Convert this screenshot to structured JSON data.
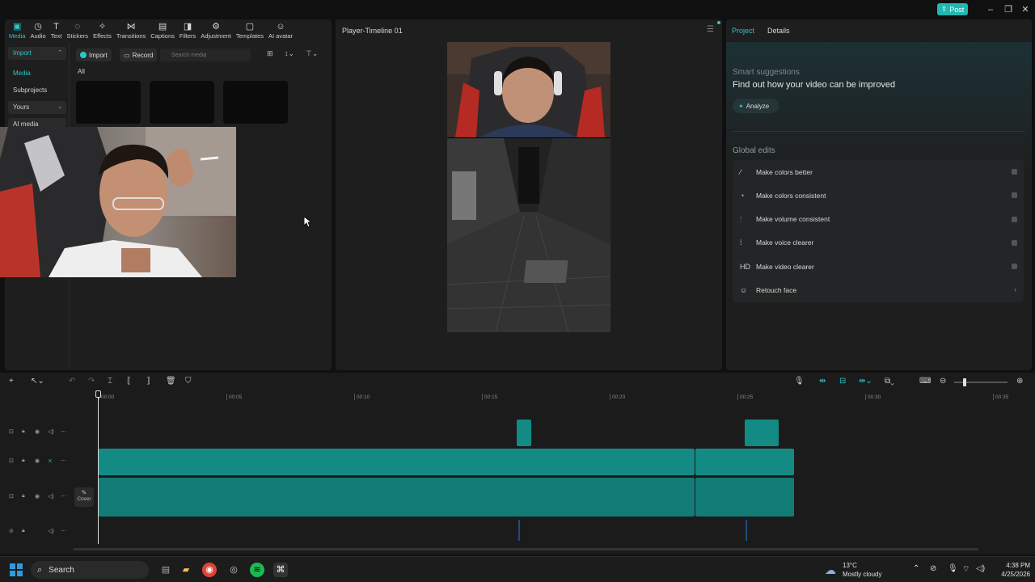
{
  "topbar": {
    "post_label": "Post"
  },
  "toolbar_tabs": [
    {
      "label": "Media",
      "icon": "media-icon",
      "active": true
    },
    {
      "label": "Audio",
      "icon": "audio-icon"
    },
    {
      "label": "Text",
      "icon": "text-icon"
    },
    {
      "label": "Stickers",
      "icon": "stickers-icon"
    },
    {
      "label": "Effects",
      "icon": "effects-icon"
    },
    {
      "label": "Transitions",
      "icon": "transitions-icon"
    },
    {
      "label": "Captions",
      "icon": "captions-icon"
    },
    {
      "label": "Filters",
      "icon": "filters-icon"
    },
    {
      "label": "Adjustment",
      "icon": "adjustment-icon"
    },
    {
      "label": "Templates",
      "icon": "templates-icon"
    },
    {
      "label": "AI avatar",
      "icon": "ai-avatar-icon"
    }
  ],
  "media": {
    "sidebar": {
      "import": "Import",
      "media": "Media",
      "subprojects": "Subprojects",
      "yours": "Yours",
      "ai_media": "AI media"
    },
    "import_label": "Import",
    "record_label": "Record",
    "search_placeholder": "Search media",
    "all_label": "All"
  },
  "player": {
    "title": "Player-Timeline 01"
  },
  "right_panel": {
    "tabs": {
      "project": "Project",
      "details": "Details"
    },
    "smart_label": "Smart suggestions",
    "smart_title": "Find out how your video can be improved",
    "analyze_label": "Analyze",
    "global_label": "Global edits",
    "edits": [
      {
        "label": "Make colors better",
        "icon": "magic-wand-icon",
        "glyph": "⁄"
      },
      {
        "label": "Make colors consistent",
        "icon": "palette-icon",
        "glyph": "◔"
      },
      {
        "label": "Make volume consistent",
        "icon": "sliders-icon",
        "glyph": "⫶"
      },
      {
        "label": "Make voice clearer",
        "icon": "voice-icon",
        "glyph": "⁞"
      },
      {
        "label": "Make video clearer",
        "icon": "hd-icon",
        "glyph": "HD"
      },
      {
        "label": "Retouch face",
        "icon": "face-icon",
        "glyph": "☺"
      }
    ]
  },
  "timeline": {
    "ruler": [
      "00:00",
      "00:05",
      "00:10",
      "00:15",
      "00:20",
      "00:25",
      "00:30",
      "00:35"
    ],
    "cover_label": "Cover"
  },
  "taskbar": {
    "search_label": "Search",
    "weather_temp": "13°C",
    "weather_desc": "Mostly cloudy",
    "time": "4:38 PM",
    "date": "4/25/2026"
  }
}
